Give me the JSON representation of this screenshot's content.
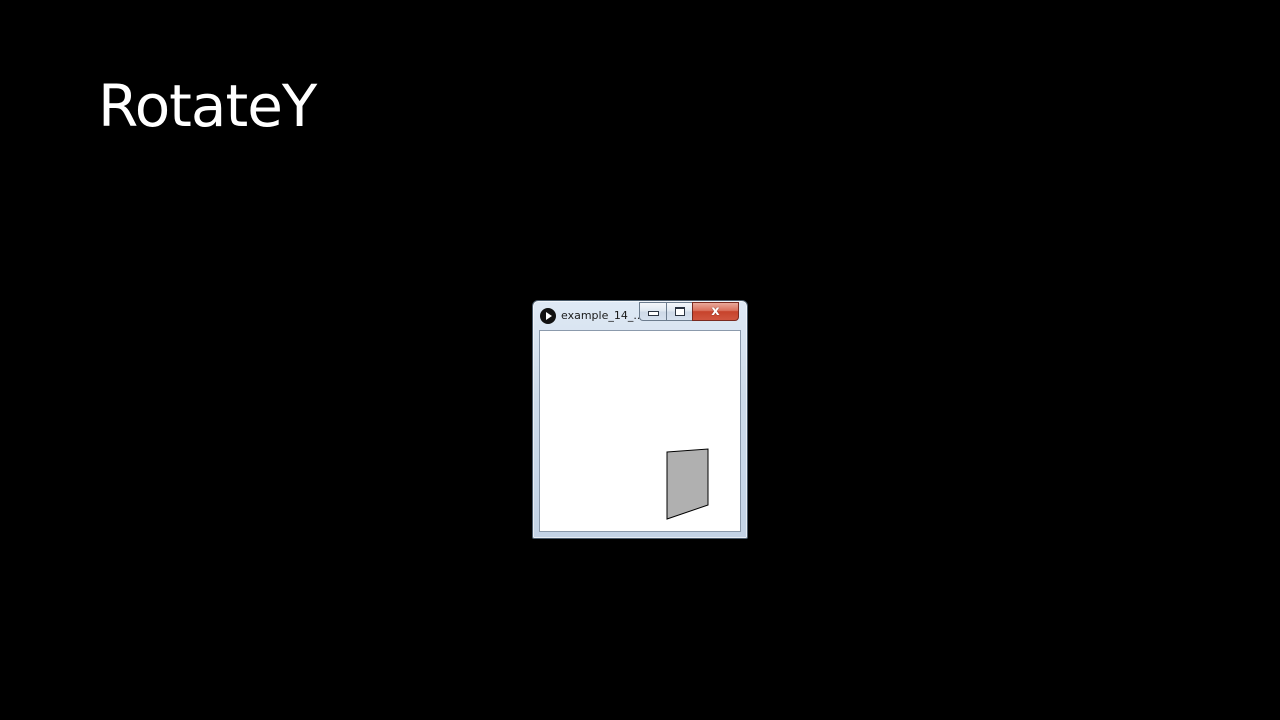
{
  "slide": {
    "title": "RotateY",
    "background": "#000000",
    "text_color": "#ffffff"
  },
  "window": {
    "title": "example_14_...",
    "app_icon": "play-icon",
    "buttons": {
      "minimize_icon": "minimize-icon",
      "maximize_icon": "maximize-icon",
      "close_label": "x",
      "close_color": "#c7432c"
    },
    "canvas": {
      "background": "#ffffff",
      "shape": {
        "kind": "rotated-rectangle",
        "fill": "#b0b0b0",
        "stroke": "#000000"
      }
    }
  }
}
